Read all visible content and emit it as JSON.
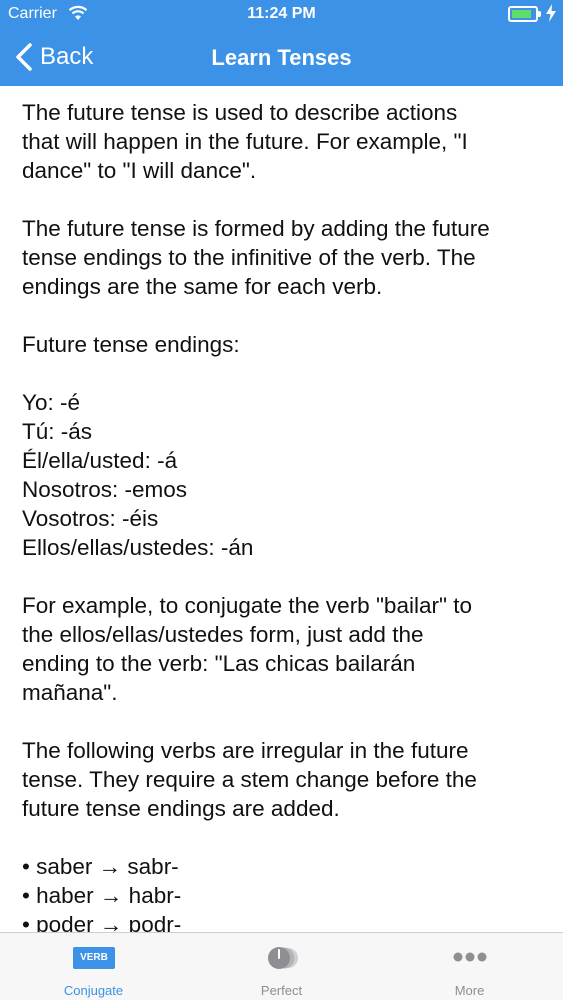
{
  "status_bar": {
    "carrier": "Carrier",
    "time": "11:24 PM",
    "battery_charging": true,
    "battery_level": 0.8
  },
  "nav": {
    "back_label": "Back",
    "title": "Learn Tenses"
  },
  "content": {
    "para1": [
      "The future tense is used to describe actions",
      "that will happen in the future. For example, \"I",
      "dance\" to \"I will dance\"."
    ],
    "para2": [
      "The future tense is formed by adding the future",
      "tense endings to the infinitive of the verb. The",
      "endings are the same for each verb."
    ],
    "para3": "Future tense endings:",
    "endings": [
      "Yo: -é",
      "Tú: -ás",
      "Él/ella/usted: -á",
      "Nosotros: -emos",
      "Vosotros: -éis",
      "Ellos/ellas/ustedes: -án"
    ],
    "para4": [
      "For example, to conjugate the verb \"bailar\" to",
      "the ellos/ellas/ustedes form, just add the",
      "ending to the verb: \"Las chicas bailarán",
      "mañana\"."
    ],
    "para5": [
      "The following verbs are irregular in the future",
      "tense. They require a stem change before the",
      "future tense endings are added."
    ],
    "irregular": [
      "• saber → sabr-",
      "• haber → habr-",
      "• poder → podr-"
    ]
  },
  "tabbar": {
    "tabs": [
      {
        "label": "Conjugate",
        "icon_text": "VERB",
        "icon": "verb-icon",
        "active": true
      },
      {
        "label": "Perfect",
        "icon": "perfect-icon",
        "active": false
      },
      {
        "label": "More",
        "icon": "more-icon",
        "active": false
      }
    ]
  },
  "colors": {
    "accent": "#3b92e6",
    "tab_inactive": "#8e8e93",
    "battery_fill": "#5fdc6a"
  }
}
